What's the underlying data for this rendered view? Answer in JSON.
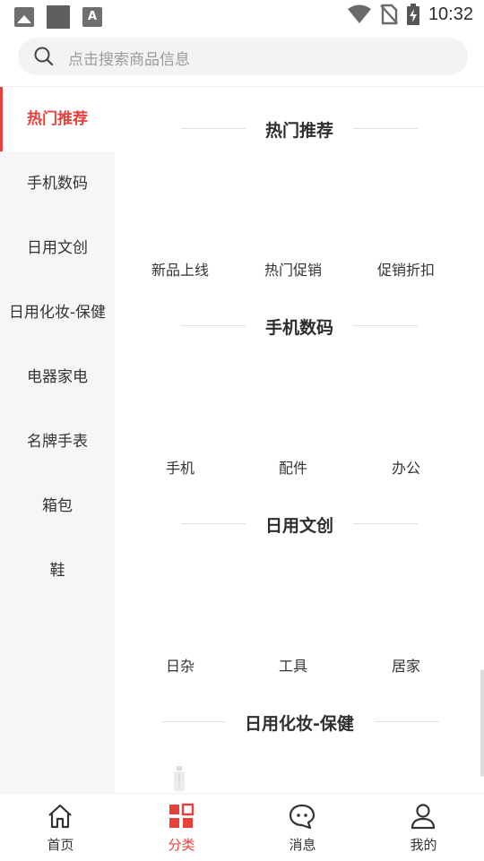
{
  "status_bar": {
    "time": "10:32",
    "left_icons": [
      "image-notification-icon",
      "square-notification-icon",
      "text-notification-icon"
    ],
    "right_icons": [
      "wifi-icon",
      "no-sim-icon",
      "battery-charging-icon"
    ],
    "text_icon_glyph": "A"
  },
  "search": {
    "placeholder": "点击搜索商品信息"
  },
  "sidebar": {
    "items": [
      {
        "label": "热门推荐",
        "active": true
      },
      {
        "label": "手机数码",
        "active": false
      },
      {
        "label": "日用文创",
        "active": false
      },
      {
        "label": "日用化妆-保健",
        "active": false
      },
      {
        "label": "电器家电",
        "active": false
      },
      {
        "label": "名牌手表",
        "active": false
      },
      {
        "label": "箱包",
        "active": false
      },
      {
        "label": "鞋",
        "active": false
      }
    ]
  },
  "sections": [
    {
      "title": "热门推荐",
      "items": [
        "新品上线",
        "热门促销",
        "促销折扣"
      ]
    },
    {
      "title": "手机数码",
      "items": [
        "手机",
        "配件",
        "办公"
      ]
    },
    {
      "title": "日用文创",
      "items": [
        "日杂",
        "工具",
        "居家"
      ]
    },
    {
      "title": "日用化妆-保健",
      "items": []
    }
  ],
  "bottom_nav": [
    {
      "label": "首页",
      "icon": "home-icon",
      "active": false
    },
    {
      "label": "分类",
      "icon": "category-icon",
      "active": true
    },
    {
      "label": "消息",
      "icon": "message-icon",
      "active": false
    },
    {
      "label": "我的",
      "icon": "profile-icon",
      "active": false
    }
  ],
  "colors": {
    "accent": "#e8403b",
    "sidebar_bg": "#f6f6f6",
    "search_bg": "#f3f3f3"
  }
}
